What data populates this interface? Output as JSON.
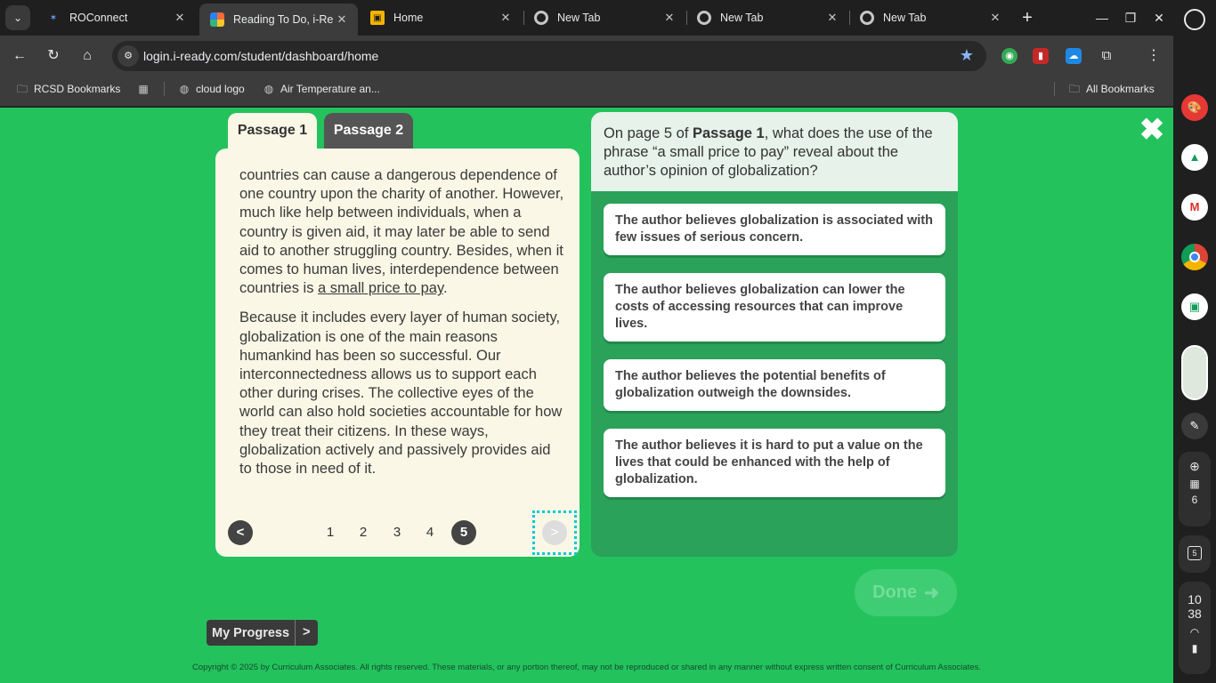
{
  "browser": {
    "tabs": [
      {
        "title": "ROConnect",
        "active": false
      },
      {
        "title": "Reading To Do, i-Read",
        "active": true
      },
      {
        "title": "Home",
        "active": false
      },
      {
        "title": "New Tab",
        "active": false
      },
      {
        "title": "New Tab",
        "active": false
      },
      {
        "title": "New Tab",
        "active": false
      }
    ],
    "url": "login.i-ready.com/student/dashboard/home",
    "bookmarks": [
      "RCSD Bookmarks",
      "cloud logo",
      "Air Temperature an...",
      "All Bookmarks"
    ]
  },
  "passage_tabs": [
    "Passage 1",
    "Passage 2"
  ],
  "passage": {
    "p1_text": "countries can cause a dangerous dependence of one country upon the charity of another. However, much like help between individuals, when a country is given aid, it may later be able to send aid to another struggling country. Besides, when it comes to human lives, interdependence between countries is ",
    "p1_underline": "a small price to pay",
    "p1_end": ".",
    "p2_text": "Because it includes every layer of human society, globalization is one of the main reasons humankind has been so successful. Our interconnectedness allows us to support each other during crises. The collective eyes of the world can also hold societies accountable for how they treat their citizens. In these ways, globalization actively and passively provides aid to those in need of it."
  },
  "pagination": {
    "prev": "<",
    "pages": [
      "1",
      "2",
      "3",
      "4",
      "5"
    ],
    "current": "5",
    "next": ">"
  },
  "question": {
    "pre": "On page 5 of ",
    "bold": "Passage 1",
    "post": ", what does the use of the phrase “a small price to pay” reveal about the author’s opinion of globalization?"
  },
  "answers": [
    "The author believes globalization is associated with few issues of serious concern.",
    "The author believes globalization can lower the costs of accessing resources that can improve lives.",
    "The author believes the potential benefits of globalization outweigh the downsides.",
    "The author believes it is hard to put a value on the lives that could be enhanced with the help of globalization."
  ],
  "done_label": "Done",
  "my_progress": {
    "label": "My Progress",
    "arrow": ">"
  },
  "copyright": "Copyright © 2025 by Curriculum Associates. All rights reserved. These materials, or any portion thereof, may not be reproduced or shared in any manner without express written consent of Curriculum Associates.",
  "shelf": {
    "notifications": "6",
    "date": "5",
    "time_hour": "10",
    "time_min": "38"
  }
}
